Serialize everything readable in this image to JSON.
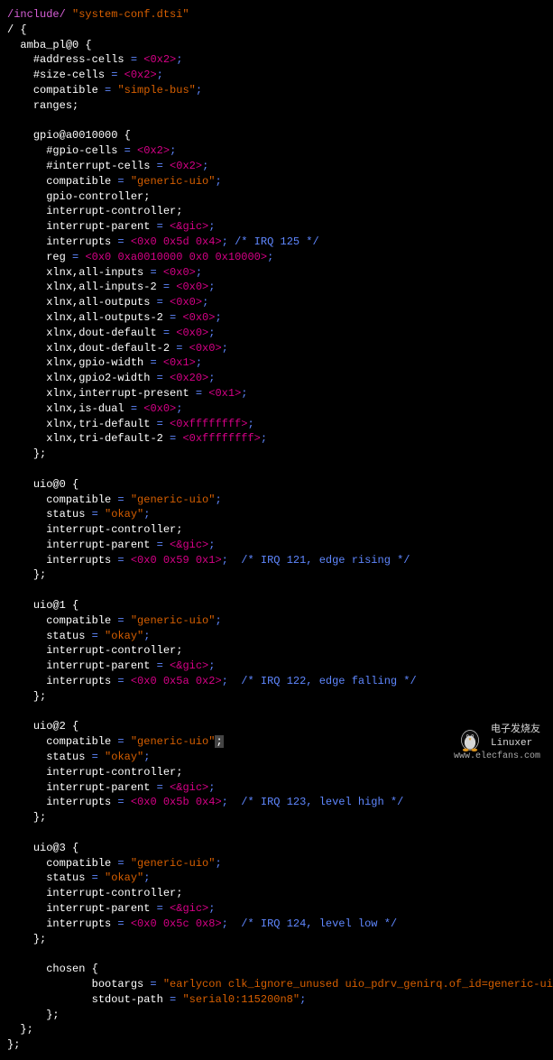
{
  "include_kw": "/include/",
  "include_file": "\"system-conf.dtsi\"",
  "root_open": "/ {",
  "amba_open": "amba_pl@0 {",
  "amba": {
    "addr": "#address-cells",
    "addr_v": "<0x2>",
    "size": "#size-cells",
    "size_v": "<0x2>",
    "compat": "compatible",
    "compat_v": "\"simple-bus\"",
    "ranges": "ranges;"
  },
  "gpio_open": "gpio@a0010000 {",
  "gpio": {
    "gcells": "#gpio-cells",
    "gcells_v": "<0x2>",
    "icells": "#interrupt-cells",
    "icells_v": "<0x2>",
    "compat": "compatible",
    "compat_v": "\"generic-uio\"",
    "gctrl": "gpio-controller;",
    "ictrl": "interrupt-controller;",
    "iparent": "interrupt-parent",
    "iparent_v": "<&gic>",
    "ints": "interrupts",
    "ints_v": "<0x0 0x5d 0x4>",
    "ints_c": "/* IRQ 125 */",
    "reg": "reg",
    "reg_v": "<0x0 0xa0010000 0x0 0x10000>",
    "p1": "xlnx,all-inputs",
    "p1v": "<0x0>",
    "p2": "xlnx,all-inputs-2",
    "p2v": "<0x0>",
    "p3": "xlnx,all-outputs",
    "p3v": "<0x0>",
    "p4": "xlnx,all-outputs-2",
    "p4v": "<0x0>",
    "p5": "xlnx,dout-default",
    "p5v": "<0x0>",
    "p6": "xlnx,dout-default-2",
    "p6v": "<0x0>",
    "p7": "xlnx,gpio-width",
    "p7v": "<0x1>",
    "p8": "xlnx,gpio2-width",
    "p8v": "<0x20>",
    "p9": "xlnx,interrupt-present",
    "p9v": "<0x1>",
    "p10": "xlnx,is-dual",
    "p10v": "<0x0>",
    "p11": "xlnx,tri-default",
    "p11v": "<0xffffffff>",
    "p12": "xlnx,tri-default-2",
    "p12v": "<0xffffffff>"
  },
  "close": "};",
  "uio0_open": "uio@0 {",
  "uio0": {
    "compat": "compatible",
    "compat_v": "\"generic-uio\"",
    "status": "status",
    "status_v": "\"okay\"",
    "ictrl": "interrupt-controller;",
    "iparent": "interrupt-parent",
    "iparent_v": "<&gic>",
    "ints": "interrupts",
    "ints_v": "<0x0 0x59 0x1>",
    "ints_c": "/* IRQ 121, edge rising */"
  },
  "uio1_open": "uio@1 {",
  "uio1": {
    "compat": "compatible",
    "compat_v": "\"generic-uio\"",
    "status": "status",
    "status_v": "\"okay\"",
    "ictrl": "interrupt-controller;",
    "iparent": "interrupt-parent",
    "iparent_v": "<&gic>",
    "ints": "interrupts",
    "ints_v": "<0x0 0x5a 0x2>",
    "ints_c": "/* IRQ 122, edge falling */"
  },
  "uio2_open": "uio@2 {",
  "uio2": {
    "compat": "compatible",
    "compat_v": "\"generic-uio\"",
    "status": "status",
    "status_v": "\"okay\"",
    "ictrl": "interrupt-controller;",
    "iparent": "interrupt-parent",
    "iparent_v": "<&gic>",
    "ints": "interrupts",
    "ints_v": "<0x0 0x5b 0x4>",
    "ints_c": "/* IRQ 123, level high */"
  },
  "uio3_open": "uio@3 {",
  "uio3": {
    "compat": "compatible",
    "compat_v": "\"generic-uio\"",
    "status": "status",
    "status_v": "\"okay\"",
    "ictrl": "interrupt-controller;",
    "iparent": "interrupt-parent",
    "iparent_v": "<&gic>",
    "ints": "interrupts",
    "ints_v": "<0x0 0x5c 0x8>",
    "ints_c": "/* IRQ 124, level low */"
  },
  "chosen_open": "chosen {",
  "chosen": {
    "boot": "bootargs",
    "boot_v": "\"earlycon clk_ignore_unused uio_pdrv_genirq.of_id=generic-uio\"",
    "stdout": "stdout-path",
    "stdout_v": "\"serial0:115200n8\""
  },
  "eq": " = ",
  "semi": ";",
  "cursor": ";",
  "watermark1": "电子发烧友",
  "watermark2": "Linuxer",
  "watermark3": "www.elecfans.com"
}
